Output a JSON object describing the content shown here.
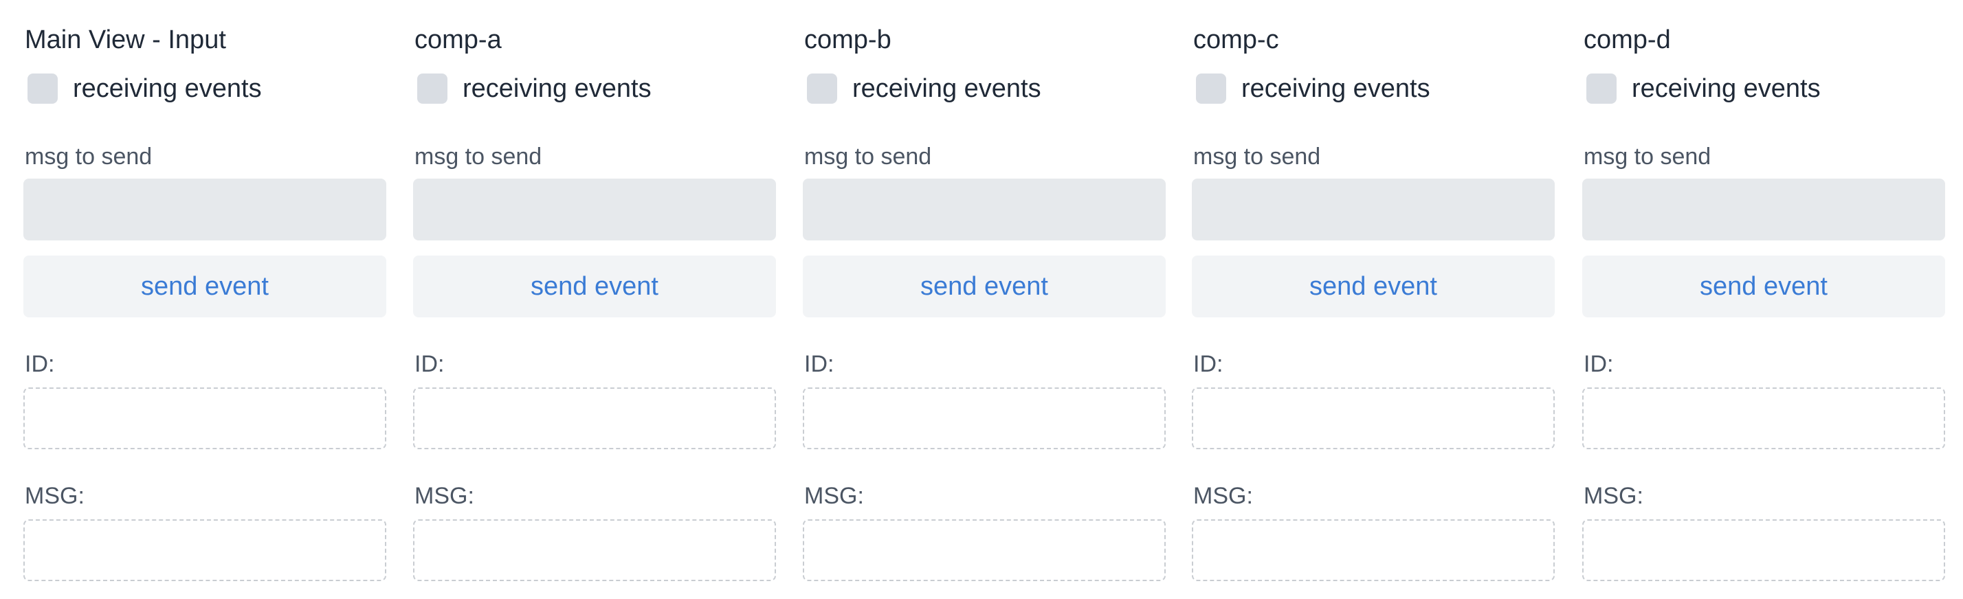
{
  "panels": [
    {
      "title": "Main View - Input",
      "checkbox_label": "receiving events",
      "msg_label": "msg to send",
      "msg_value": "",
      "msg_placeholder": "",
      "button_label": "send event",
      "id_label": "ID:",
      "id_value": "",
      "msg_out_label": "MSG:",
      "msg_out_value": ""
    },
    {
      "title": "comp-a",
      "checkbox_label": "receiving events",
      "msg_label": "msg to send",
      "msg_value": "",
      "msg_placeholder": "",
      "button_label": "send event",
      "id_label": "ID:",
      "id_value": "",
      "msg_out_label": "MSG:",
      "msg_out_value": ""
    },
    {
      "title": "comp-b",
      "checkbox_label": "receiving events",
      "msg_label": "msg to send",
      "msg_value": "",
      "msg_placeholder": "",
      "button_label": "send event",
      "id_label": "ID:",
      "id_value": "",
      "msg_out_label": "MSG:",
      "msg_out_value": ""
    },
    {
      "title": "comp-c",
      "checkbox_label": "receiving events",
      "msg_label": "msg to send",
      "msg_value": "",
      "msg_placeholder": "",
      "button_label": "send event",
      "id_label": "ID:",
      "id_value": "",
      "msg_out_label": "MSG:",
      "msg_out_value": ""
    },
    {
      "title": "comp-d",
      "checkbox_label": "receiving events",
      "msg_label": "msg to send",
      "msg_value": "",
      "msg_placeholder": "",
      "button_label": "send event",
      "id_label": "ID:",
      "id_value": "",
      "msg_out_label": "MSG:",
      "msg_out_value": ""
    }
  ],
  "colors": {
    "text": "#1f2937",
    "label": "#4b5563",
    "accent": "#3a7bd5",
    "checkbox": "#d9dde3",
    "input_bg": "#e6e9ec",
    "button_bg": "#f2f4f6",
    "dashed_border": "#c9cdd2"
  }
}
